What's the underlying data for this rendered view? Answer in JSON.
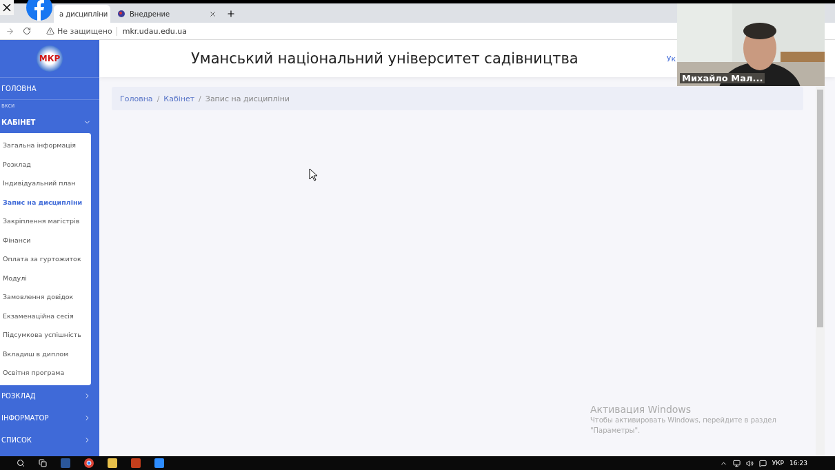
{
  "browser": {
    "tabs": [
      {
        "label": "а дисципліни",
        "selected": true
      },
      {
        "label": "Внедрение",
        "selected": false
      }
    ],
    "security": "Не защищено",
    "url": "mkr.udau.edu.ua"
  },
  "header": {
    "logo": "МКР",
    "title": "Уманський національний університет садівництва",
    "language": "Ук"
  },
  "sidebar": {
    "items": [
      {
        "label": "ГОЛОВНА",
        "kind": "link"
      },
      {
        "label": "вкси",
        "kind": "caption"
      },
      {
        "label": "КАБІНЕТ",
        "kind": "group",
        "expanded": true,
        "children": [
          {
            "label": "Загальна інформація",
            "selected": false
          },
          {
            "label": "Розклад",
            "selected": false
          },
          {
            "label": "Індивідуальний план",
            "selected": false
          },
          {
            "label": "Запис на дисципліни",
            "selected": true
          },
          {
            "label": "Закріплення магістрів",
            "selected": false
          },
          {
            "label": "Фінанси",
            "selected": false
          },
          {
            "label": "Оплата за гуртожиток",
            "selected": false
          },
          {
            "label": "Модулі",
            "selected": false
          },
          {
            "label": "Замовлення довідок",
            "selected": false
          },
          {
            "label": "Екзаменаційна сесія",
            "selected": false
          },
          {
            "label": "Підсумкова успішність",
            "selected": false
          },
          {
            "label": "Вкладиш в диплом",
            "selected": false
          },
          {
            "label": "Освітня програма",
            "selected": false
          }
        ]
      },
      {
        "label": "РОЗКЛАД",
        "kind": "group",
        "expanded": false
      },
      {
        "label": "ІНФОРМАТОР",
        "kind": "group",
        "expanded": false
      },
      {
        "label": "СПИСОК",
        "kind": "group",
        "expanded": false
      }
    ]
  },
  "breadcrumb": [
    {
      "label": "Головна",
      "selected": false
    },
    {
      "label": "Кабінет",
      "selected": false
    },
    {
      "label": "Запис на дисципліни",
      "selected": true
    }
  ],
  "breadcrumb_separator": "/",
  "activation": {
    "title": "Активация Windows",
    "text": "Чтобы активировать Windows, перейдите в раздел \"Параметры\"."
  },
  "video": {
    "name": "Михайло Мал..."
  },
  "taskbar": {
    "language": "УКР",
    "time": "16:23"
  }
}
